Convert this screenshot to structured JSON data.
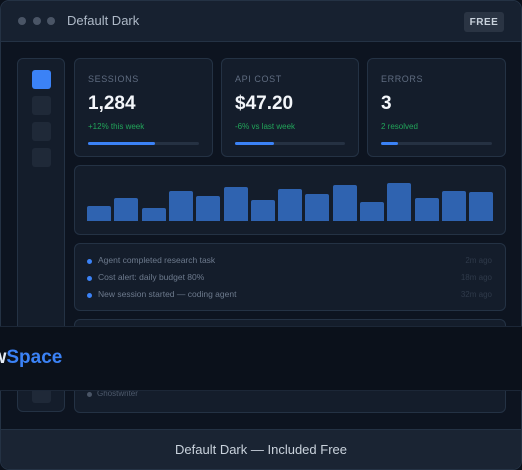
{
  "window": {
    "title": "Default Dark",
    "badge": "FREE"
  },
  "sidebar": {
    "items": [
      {
        "icon": "home-icon",
        "active": true
      },
      {
        "icon": "nav-icon",
        "active": false
      },
      {
        "icon": "nav-icon",
        "active": false
      },
      {
        "icon": "nav-icon",
        "active": false
      }
    ]
  },
  "cards": [
    {
      "label": "SESSIONS",
      "value": "1,284",
      "delta": "+12% this week",
      "progress": 0.6
    },
    {
      "label": "API COST",
      "value": "$47.20",
      "delta": "-6% vs last week",
      "progress": 0.35
    },
    {
      "label": "ERRORS",
      "value": "3",
      "delta": "2 resolved",
      "progress": 0.15
    }
  ],
  "chart_data": {
    "type": "bar",
    "values": [
      15,
      23,
      13,
      30,
      25,
      34,
      21,
      32,
      27,
      36,
      19,
      38,
      23,
      30,
      29
    ],
    "ylim": [
      0,
      40
    ],
    "color": "#2f63b0"
  },
  "activity": [
    {
      "text": "Agent completed research task",
      "time": "2m ago"
    },
    {
      "text": "Cost alert: daily budget 80%",
      "time": "18m ago"
    },
    {
      "text": "New session started — coding agent",
      "time": "32m ago"
    }
  ],
  "lower_item": {
    "label": "Ghostwriter"
  },
  "banner": {
    "part1": "aw",
    "part2": "Space"
  },
  "footer": {
    "text": "Default Dark — Included Free"
  },
  "colors": {
    "accent": "#3b82f6",
    "success": "#22a55a",
    "background": "#0d1420"
  }
}
